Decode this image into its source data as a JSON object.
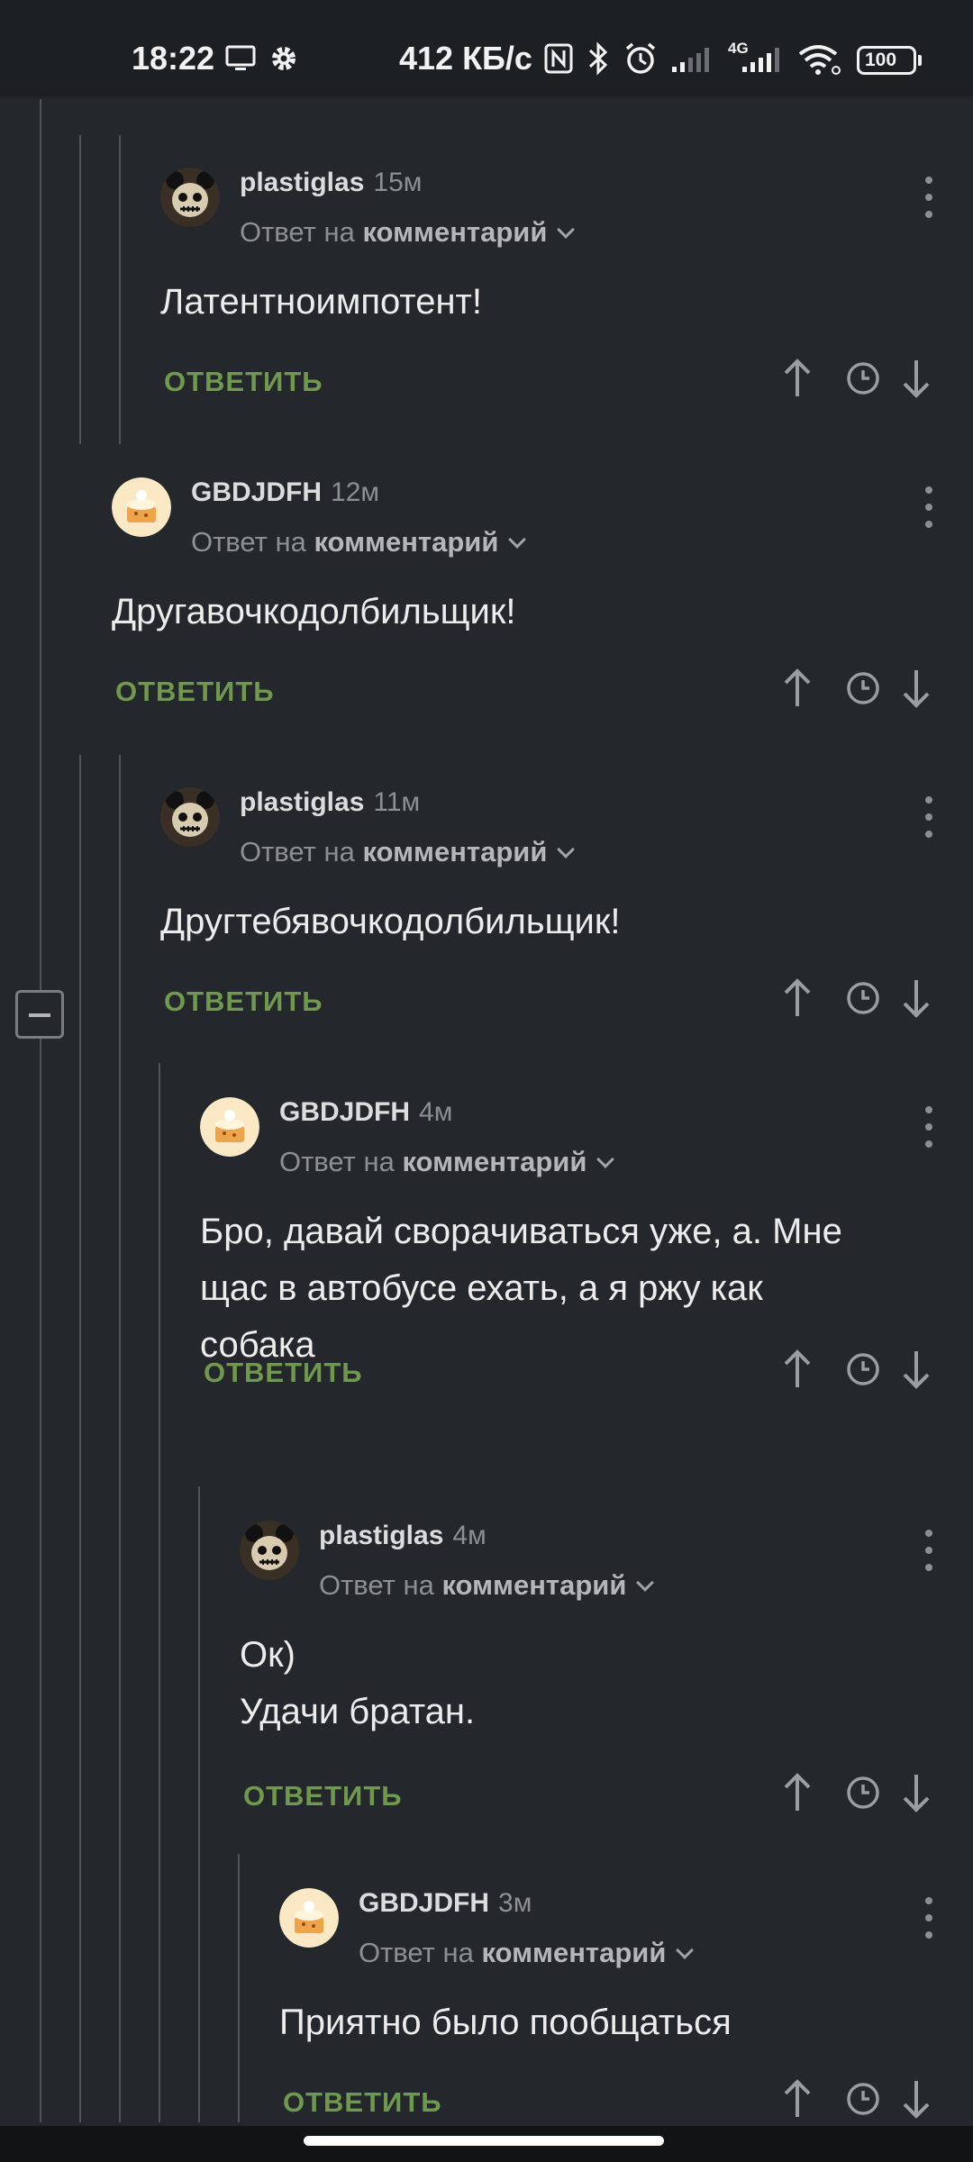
{
  "status_bar": {
    "time": "18:22",
    "network_speed": "412 КБ/с",
    "network_type": "4G",
    "battery": "100",
    "icons": [
      "screen-cast-icon",
      "gear-icon",
      "nfc-icon",
      "bluetooth-icon",
      "alarm-icon",
      "signal-icon",
      "signal-4g-icon",
      "wifi-icon",
      "battery-icon"
    ]
  },
  "reply_to_prefix": "Ответ на",
  "reply_to_target": "комментарий",
  "reply_label": "ОТВЕТИТЬ",
  "colors": {
    "background": "#24272b",
    "reply_green": "#6f9a4e",
    "text": "#ececec",
    "muted": "#8c8f94"
  },
  "comments": [
    {
      "username": "plastiglas",
      "time": "15м",
      "avatar": "skull-avatar",
      "text_lines": [
        "Латентноимпотент!"
      ]
    },
    {
      "username": "GBDJDFH",
      "time": "12м",
      "avatar": "cake-avatar",
      "text_lines": [
        "Другавочкодолбильщик!"
      ]
    },
    {
      "username": "plastiglas",
      "time": "11м",
      "avatar": "skull-avatar",
      "text_lines": [
        "Другтебявочкодолбильщик!"
      ]
    },
    {
      "username": "GBDJDFH",
      "time": "4м",
      "avatar": "cake-avatar",
      "text_lines": [
        "Бро, давай сворачиваться уже, а. Мне",
        "щас в автобусе ехать, а я ржу как",
        "собака"
      ]
    },
    {
      "username": "plastiglas",
      "time": "4м",
      "avatar": "skull-avatar",
      "text_lines": [
        "Ок)",
        "Удачи братан."
      ]
    },
    {
      "username": "GBDJDFH",
      "time": "3м",
      "avatar": "cake-avatar",
      "text_lines": [
        "Приятно было пообщаться"
      ]
    }
  ]
}
